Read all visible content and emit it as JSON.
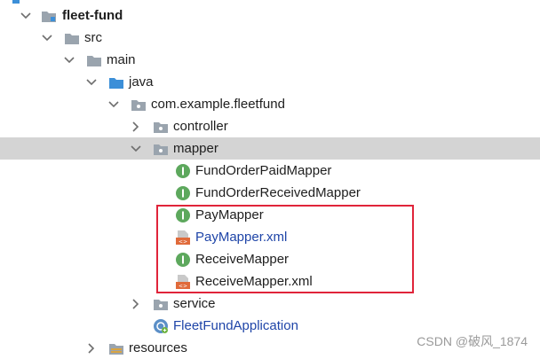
{
  "project_tree": {
    "root": {
      "label": "fleet-fund",
      "expanded": true
    },
    "items": [
      {
        "label": "src",
        "type": "folder",
        "depth": 1,
        "expanded": true
      },
      {
        "label": "main",
        "type": "folder",
        "depth": 2,
        "expanded": true
      },
      {
        "label": "java",
        "type": "source-folder",
        "depth": 3,
        "expanded": true
      },
      {
        "label": "com.example.fleetfund",
        "type": "package",
        "depth": 4,
        "expanded": true
      },
      {
        "label": "controller",
        "type": "package",
        "depth": 5,
        "expanded": false
      },
      {
        "label": "mapper",
        "type": "package",
        "depth": 5,
        "expanded": true,
        "selected": true
      },
      {
        "label": "FundOrderPaidMapper",
        "type": "interface",
        "depth": 6
      },
      {
        "label": "FundOrderReceivedMapper",
        "type": "interface",
        "depth": 6
      },
      {
        "label": "PayMapper",
        "type": "interface",
        "depth": 6
      },
      {
        "label": "PayMapper.xml",
        "type": "xml",
        "depth": 6
      },
      {
        "label": "ReceiveMapper",
        "type": "interface",
        "depth": 6
      },
      {
        "label": "ReceiveMapper.xml",
        "type": "xml",
        "depth": 6
      },
      {
        "label": "service",
        "type": "package",
        "depth": 5,
        "expanded": false
      },
      {
        "label": "FleetFundApplication",
        "type": "spring-app",
        "depth": 5
      },
      {
        "label": "resources",
        "type": "resources-folder",
        "depth": 3,
        "expanded": false
      }
    ]
  },
  "watermark": "CSDN @破风_1874",
  "colors": {
    "selection": "#d4d4d4",
    "highlight": "#e0243a",
    "interface_green": "#5da85d",
    "xml_orange": "#e06a3a",
    "blue_text": "#1f45a8"
  }
}
